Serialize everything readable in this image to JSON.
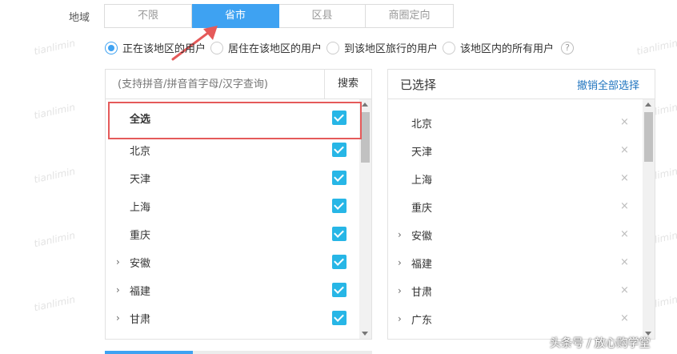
{
  "region": {
    "label": "地域",
    "tabs": [
      {
        "label": "不限",
        "active": false
      },
      {
        "label": "省市",
        "active": true
      },
      {
        "label": "区县",
        "active": false
      },
      {
        "label": "商圈定向",
        "active": false
      }
    ]
  },
  "user_type": {
    "options": [
      {
        "label": "正在该地区的用户",
        "selected": true
      },
      {
        "label": "居住在该地区的用户",
        "selected": false
      },
      {
        "label": "到该地区旅行的用户",
        "selected": false
      },
      {
        "label": "该地区内的所有用户",
        "selected": false
      }
    ],
    "help_icon": "?"
  },
  "picker": {
    "search_placeholder": "(支持拼音/拼音首字母/汉字查询)",
    "search_button": "搜索",
    "items": [
      {
        "label": "全选",
        "checked": true,
        "expandable": false
      },
      {
        "label": "北京",
        "checked": true,
        "expandable": false
      },
      {
        "label": "天津",
        "checked": true,
        "expandable": false
      },
      {
        "label": "上海",
        "checked": true,
        "expandable": false
      },
      {
        "label": "重庆",
        "checked": true,
        "expandable": false
      },
      {
        "label": "安徽",
        "checked": true,
        "expandable": true
      },
      {
        "label": "福建",
        "checked": true,
        "expandable": true
      },
      {
        "label": "甘肃",
        "checked": true,
        "expandable": true
      }
    ]
  },
  "selected": {
    "title": "已选择",
    "clear_all": "撤销全部选择",
    "items": [
      {
        "label": "北京",
        "expandable": false
      },
      {
        "label": "天津",
        "expandable": false
      },
      {
        "label": "上海",
        "expandable": false
      },
      {
        "label": "重庆",
        "expandable": false
      },
      {
        "label": "安徽",
        "expandable": true
      },
      {
        "label": "福建",
        "expandable": true
      },
      {
        "label": "甘肃",
        "expandable": true
      },
      {
        "label": "广东",
        "expandable": true
      }
    ],
    "remove_icon": "×"
  },
  "watermark_text": "tianlimin",
  "credit": "头条号 / 放心购学堂",
  "colors": {
    "accent": "#3ea2f2",
    "checkbox": "#27b6e6",
    "highlight": "#e55a5a",
    "link": "#1f74bf"
  },
  "icons": {
    "expand": "chevron-right-icon",
    "remove": "close-icon",
    "radio": "radio-icon",
    "help": "question-icon"
  }
}
